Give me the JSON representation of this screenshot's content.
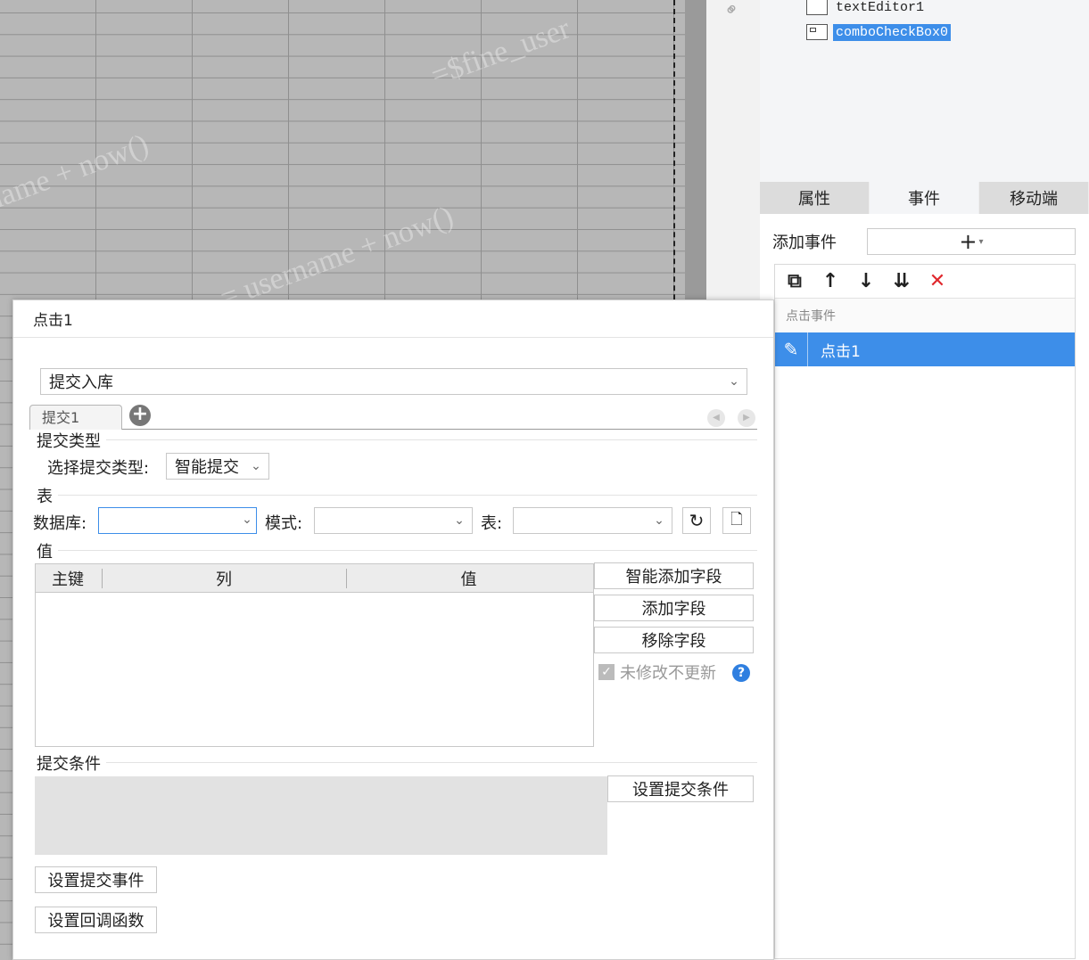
{
  "sheet": {
    "watermarks": [
      "=$fine_user",
      "name + now()",
      "= username + now()"
    ]
  },
  "tree": {
    "items": [
      {
        "label": "textEditor1",
        "selected": false
      },
      {
        "label": "comboCheckBox0",
        "selected": true
      }
    ]
  },
  "panel": {
    "tabs": [
      {
        "label": "属性",
        "active": false
      },
      {
        "label": "事件",
        "active": true
      },
      {
        "label": "移动端",
        "active": false
      }
    ],
    "add_event_label": "添加事件",
    "add_event_symbol": "+",
    "add_event_caret": "▾",
    "toolbar": {
      "copy_icon": "⧉",
      "up_icon": "↑",
      "down_icon": "↓",
      "bottom_icon": "⇊",
      "delete_icon": "✕"
    },
    "event_group": "点击事件",
    "event_item": "点击1"
  },
  "dialog": {
    "title": "点击1",
    "action_value": "提交入库",
    "sub_tab": "提交1",
    "submit_type_section": "提交类型",
    "submit_type_label": "选择提交类型:",
    "submit_type_value": "智能提交",
    "table_section": "表",
    "database_label": "数据库:",
    "database_value": "",
    "schema_label": "模式:",
    "schema_value": "",
    "table_label": "表:",
    "table_value": "",
    "value_section": "值",
    "grid_headers": [
      "主键",
      "列",
      "值"
    ],
    "smart_add_field": "智能添加字段",
    "add_field": "添加字段",
    "remove_field": "移除字段",
    "checkbox_label": "未修改不更新",
    "checkbox_checked": true,
    "condition_section": "提交条件",
    "set_condition": "设置提交条件",
    "set_submit_event": "设置提交事件",
    "set_callback": "设置回调函数"
  },
  "colors": {
    "accent": "#3d8ee9",
    "delete": "#e0282d",
    "help": "#2f7fe0"
  }
}
